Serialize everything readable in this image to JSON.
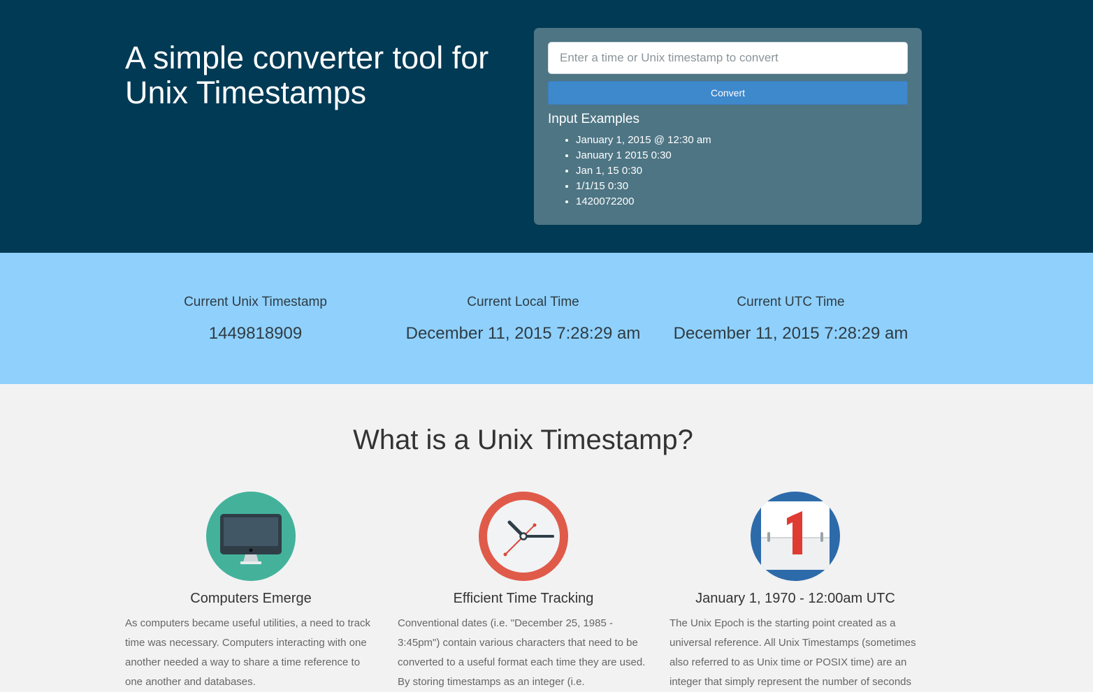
{
  "hero": {
    "title": "A simple converter tool for Unix Timestamps",
    "input_placeholder": "Enter a time or Unix timestamp to convert",
    "convert_label": "Convert",
    "examples_title": "Input Examples",
    "examples": [
      "January 1, 2015 @ 12:30 am",
      "January 1 2015 0:30",
      "Jan 1, 15 0:30",
      "1/1/15 0:30",
      "1420072200"
    ]
  },
  "stats": [
    {
      "label": "Current Unix Timestamp",
      "value": "1449818909"
    },
    {
      "label": "Current Local Time",
      "value": "December 11, 2015 7:28:29 am"
    },
    {
      "label": "Current UTC Time",
      "value": "December 11, 2015 7:28:29 am"
    }
  ],
  "info": {
    "title": "What is a Unix Timestamp?",
    "columns": [
      {
        "icon": "monitor-icon",
        "title": "Computers Emerge",
        "text": "As computers became useful utilities, a need to track time was necessary. Computers interacting with one another needed a way to share a time reference to one another and databases."
      },
      {
        "icon": "clock-icon",
        "title": "Efficient Time Tracking",
        "text": "Conventional dates (i.e. \"December 25, 1985 - 3:45pm\") contain various characters that need to be converted to a useful format each time they are used. By storing timestamps as an integer (i.e."
      },
      {
        "icon": "calendar-icon",
        "title": "January 1, 1970 - 12:00am UTC",
        "text": "The Unix Epoch is the starting point created as a universal reference. All Unix Timestamps (sometimes also referred to as Unix time or POSIX time) are an integer that simply represent the number of seconds"
      }
    ]
  },
  "colors": {
    "hero_bg": "#003a55",
    "panel_bg": "#4e7584",
    "button": "#3e88cc",
    "stats_bg": "#8fd1fc",
    "monitor": "#44b29b",
    "clock": "#e05a4a",
    "calendar": "#2d6aaa"
  }
}
